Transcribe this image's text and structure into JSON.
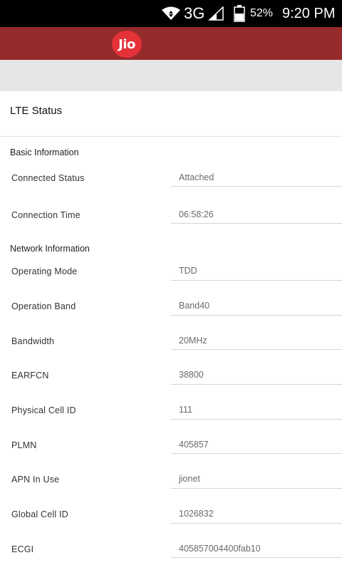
{
  "status_bar": {
    "network_type": "3G",
    "battery_percent": "52%",
    "time": "9:20 PM",
    "icons": [
      "wifi-icon",
      "signal-icon",
      "battery-icon"
    ]
  },
  "app_bar": {
    "logo_text": "Jio",
    "color": "#952A2B",
    "logo_color": "#E53238"
  },
  "page": {
    "title": "LTE Status"
  },
  "sections": [
    {
      "header": "Basic Information",
      "rows": [
        {
          "label": "Connected Status",
          "value": "Attached"
        },
        {
          "label": "Connection Time",
          "value": "06:58:26"
        }
      ]
    },
    {
      "header": "Network Information",
      "rows": [
        {
          "label": "Operating Mode",
          "value": "TDD"
        },
        {
          "label": "Operation Band",
          "value": "Band40"
        },
        {
          "label": "Bandwidth",
          "value": "20MHz"
        },
        {
          "label": "EARFCN",
          "value": "38800"
        },
        {
          "label": "Physical Cell ID",
          "value": "111"
        },
        {
          "label": "PLMN",
          "value": "405857"
        },
        {
          "label": "APN In Use",
          "value": "jionet"
        },
        {
          "label": "Global Cell ID",
          "value": "1026832"
        },
        {
          "label": "ECGI",
          "value": "405857004400fab10"
        }
      ]
    }
  ]
}
